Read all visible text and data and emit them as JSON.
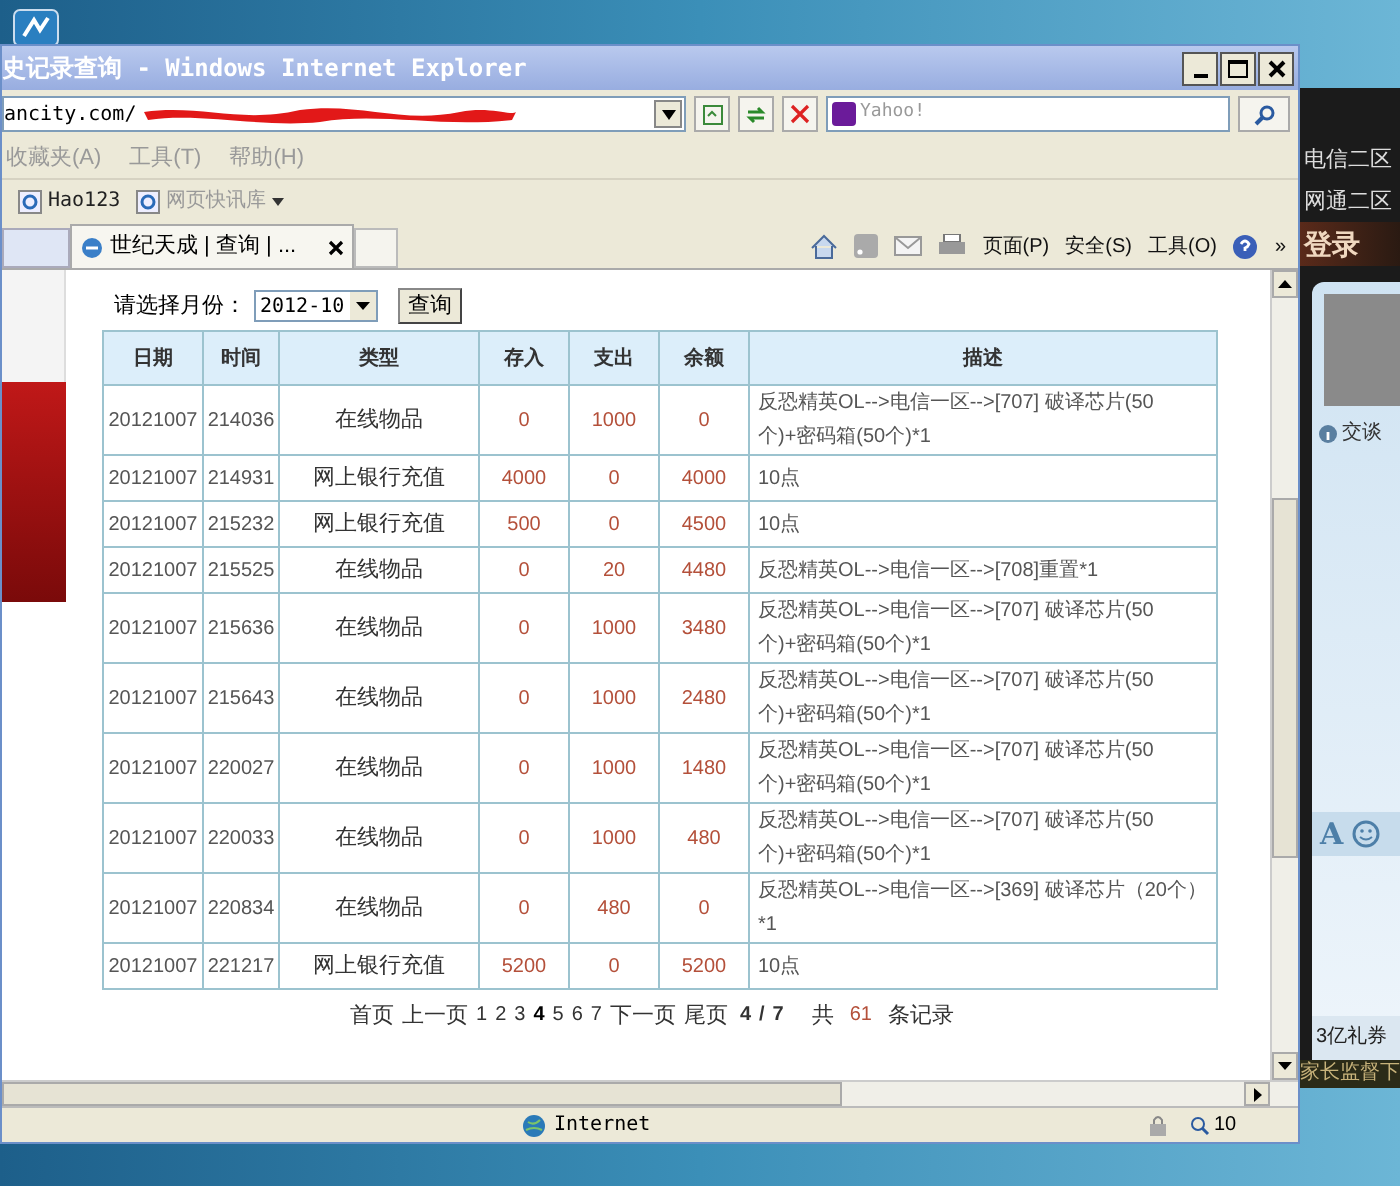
{
  "window": {
    "title": "史记录查询 - Windows Internet Explorer"
  },
  "address_bar": {
    "url": "ancity.com/",
    "search_placeholder": "Yahoo!"
  },
  "menu": [
    "收藏夹(A)",
    "工具(T)",
    "帮助(H)"
  ],
  "favorites": [
    {
      "label": "Hao123",
      "kind": "link"
    },
    {
      "label": "网页快讯库",
      "kind": "menu"
    }
  ],
  "tabs": [
    {
      "label": "世纪天成 | 查询 | ...",
      "selected": true
    }
  ],
  "command_bar": [
    "页面(P)",
    "安全(S)",
    "工具(O)",
    "»"
  ],
  "page": {
    "month_label": "请选择月份：",
    "month_value": "2012-10",
    "query_button": "查询",
    "table": {
      "columns": [
        "日期",
        "时间",
        "类型",
        "存入",
        "支出",
        "余额",
        "描述"
      ],
      "rows": [
        [
          "20121007",
          "214036",
          "在线物品",
          "0",
          "1000",
          "0",
          "反恐精英OL-->电信一区-->[707] 破译芯片(50个)+密码箱(50个)*1"
        ],
        [
          "20121007",
          "214931",
          "网上银行充值",
          "4000",
          "0",
          "4000",
          "10点"
        ],
        [
          "20121007",
          "215232",
          "网上银行充值",
          "500",
          "0",
          "4500",
          "10点"
        ],
        [
          "20121007",
          "215525",
          "在线物品",
          "0",
          "20",
          "4480",
          "反恐精英OL-->电信一区-->[708]重置*1"
        ],
        [
          "20121007",
          "215636",
          "在线物品",
          "0",
          "1000",
          "3480",
          "反恐精英OL-->电信一区-->[707] 破译芯片(50个)+密码箱(50个)*1"
        ],
        [
          "20121007",
          "215643",
          "在线物品",
          "0",
          "1000",
          "2480",
          "反恐精英OL-->电信一区-->[707] 破译芯片(50个)+密码箱(50个)*1"
        ],
        [
          "20121007",
          "220027",
          "在线物品",
          "0",
          "1000",
          "1480",
          "反恐精英OL-->电信一区-->[707] 破译芯片(50个)+密码箱(50个)*1"
        ],
        [
          "20121007",
          "220033",
          "在线物品",
          "0",
          "1000",
          "480",
          "反恐精英OL-->电信一区-->[707] 破译芯片(50个)+密码箱(50个)*1"
        ],
        [
          "20121007",
          "220834",
          "在线物品",
          "0",
          "480",
          "0",
          "反恐精英OL-->电信一区-->[369] 破译芯片（20个）*1"
        ],
        [
          "20121007",
          "221217",
          "网上银行充值",
          "5200",
          "0",
          "5200",
          "10点"
        ]
      ]
    },
    "pagination": {
      "first": "首页",
      "prev": "上一页",
      "pages": [
        {
          "label": "1",
          "selected": false
        },
        {
          "label": "2",
          "selected": false
        },
        {
          "label": "3",
          "selected": false
        },
        {
          "label": "4",
          "selected": true
        },
        {
          "label": "5",
          "selected": false
        },
        {
          "label": "6",
          "selected": false
        },
        {
          "label": "7",
          "selected": false
        }
      ],
      "next": "下一页",
      "last": "尾页",
      "current": "4",
      "separator": "/",
      "total_pages": "7",
      "total_label": "共",
      "count": "61",
      "count_label": "条记录"
    }
  },
  "status_bar": {
    "zone": "Internet",
    "zoom": "10"
  },
  "side_app": {
    "servers": [
      "电信二区",
      "网通二区"
    ],
    "login": "登录",
    "chat_status": "交谈",
    "font_button": "A",
    "coupon": "3亿礼券",
    "notice": "家长监督下"
  }
}
